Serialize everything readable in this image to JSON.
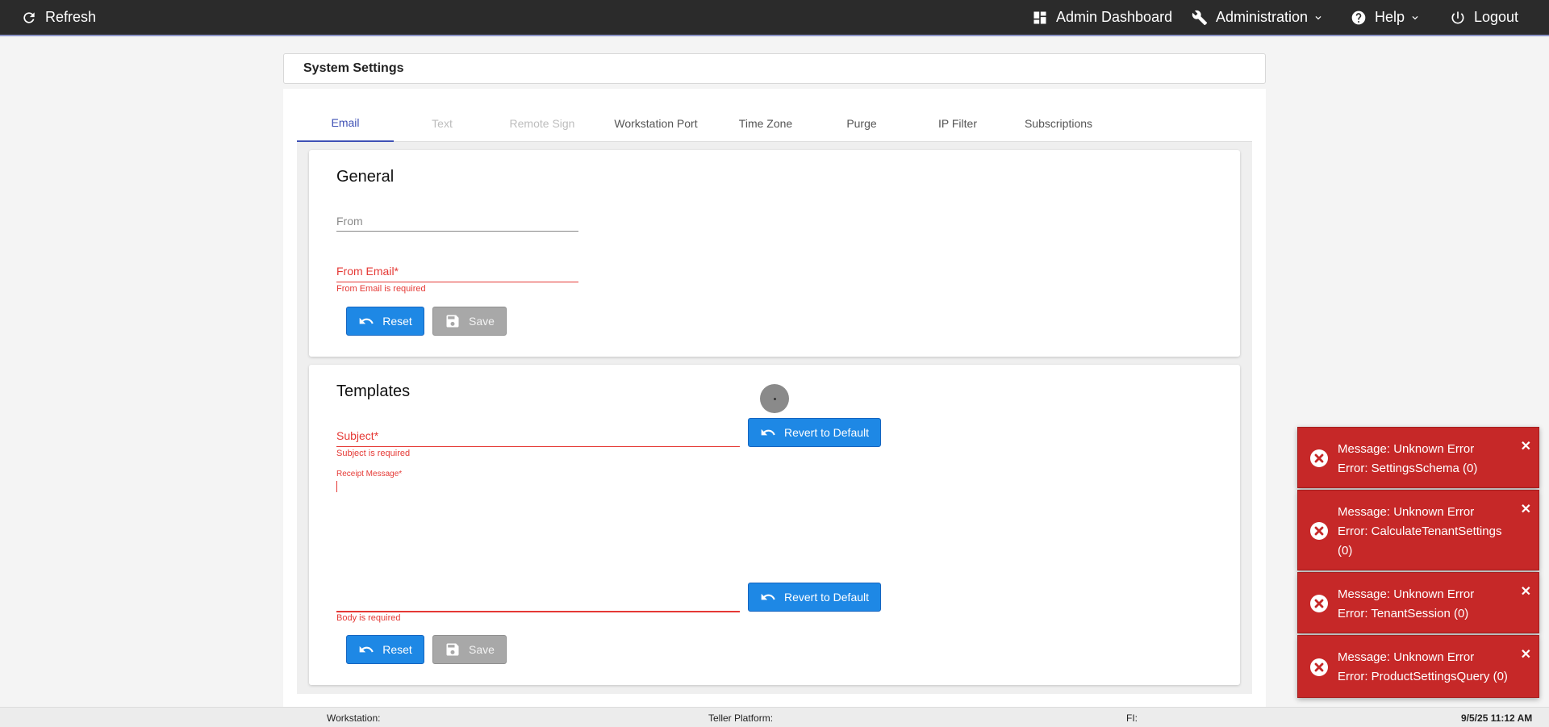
{
  "topbar": {
    "refresh_label": "Refresh",
    "admin_dashboard_label": "Admin Dashboard",
    "administration_label": "Administration",
    "help_label": "Help",
    "logout_label": "Logout"
  },
  "page": {
    "title": "System Settings"
  },
  "tabs": [
    {
      "label": "Email",
      "state": "active"
    },
    {
      "label": "Text",
      "state": "disabled"
    },
    {
      "label": "Remote Sign",
      "state": "disabled"
    },
    {
      "label": "Workstation Port",
      "state": "normal"
    },
    {
      "label": "Time Zone",
      "state": "normal"
    },
    {
      "label": "Purge",
      "state": "normal"
    },
    {
      "label": "IP Filter",
      "state": "normal"
    },
    {
      "label": "Subscriptions",
      "state": "normal"
    }
  ],
  "general": {
    "title": "General",
    "from_label": "From",
    "from_email_label": "From Email*",
    "from_email_error": "From Email is required",
    "reset_label": "Reset",
    "save_label": "Save"
  },
  "templates": {
    "title": "Templates",
    "subject_label": "Subject*",
    "subject_error": "Subject is required",
    "revert_label": "Revert to Default",
    "receipt_message_label": "Receipt Message*",
    "body_error": "Body is required",
    "revert_body_label": "Revert to Default",
    "reset_label": "Reset",
    "save_label": "Save"
  },
  "toasts": [
    {
      "message": "Message: Unknown Error",
      "error": "Error: SettingsSchema (0)"
    },
    {
      "message": "Message: Unknown Error",
      "error": "Error: CalculateTenantSettings (0)"
    },
    {
      "message": "Message: Unknown Error",
      "error": "Error: TenantSession (0)"
    },
    {
      "message": "Message: Unknown Error",
      "error": "Error: ProductSettingsQuery (0)"
    }
  ],
  "footer": {
    "workstation_label": "Workstation:",
    "teller_platform_label": "Teller Platform:",
    "fi_label": "FI:",
    "datetime": "9/5/25 11:12 AM"
  },
  "colors": {
    "topbar_bg": "#2b2b2b",
    "accent": "#3f51b5",
    "button_blue": "#1e88e5",
    "error_red": "#e53935",
    "toast_red": "#c62828"
  }
}
